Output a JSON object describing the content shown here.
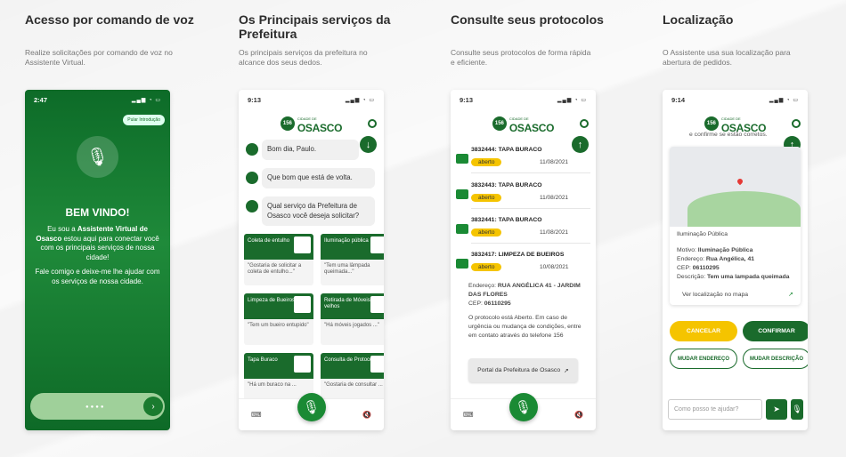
{
  "colors": {
    "green": "#1a6b2c",
    "accent_yellow": "#f5c400"
  },
  "columns": [
    {
      "title": "Acesso por comando de voz",
      "desc": "Realize solicitações por comando de voz no Assistente Virtual."
    },
    {
      "title": "Os Principais serviços da Prefeitura",
      "desc": "Os principais serviços da prefeitura no alcance dos seus dedos."
    },
    {
      "title": "Consulte seus protocolos",
      "desc": "Consulte seus protocolos de forma rápida e eficiente."
    },
    {
      "title": "Localização",
      "desc": "O Assistente usa sua localização para abertura de pedidos."
    }
  ],
  "logo": {
    "number": "156",
    "city_small": "CIDADE DE",
    "city": "OSASCO"
  },
  "phone1": {
    "time": "2:47",
    "skip": "Pular Introdução",
    "welcome": "BEM VINDO!",
    "intro_pre": "Eu sou a ",
    "intro_bold": "Assistente Virtual de Osasco",
    "intro_post": " estou aqui para conectar você com os principais serviços de nossa cidade!",
    "intro2": "Fale comigo e deixe-me lhe ajudar com os serviços de nossa cidade."
  },
  "phone2": {
    "time": "9:13",
    "msg1": "Bom dia, Paulo.",
    "msg2": "Que bom que está de volta.",
    "msg3": "Qual serviço da Prefeitura de Osasco você deseja solicitar?",
    "services": [
      {
        "title": "Coleta de entulho",
        "quote": "\"Gostaria de solicitar a coleta de entulho...\""
      },
      {
        "title": "Iluminação pública",
        "quote": "\"Tem uma lâmpada queimada...\""
      },
      {
        "title": "Limpeza de Bueiros",
        "quote": "\"Tem um bueiro entupido\""
      },
      {
        "title": "Retirada de Móveis velhos",
        "quote": "\"Há móveis jogados ...\""
      },
      {
        "title": "Tapa Buraco",
        "quote": "\"Há um buraco na ..."
      },
      {
        "title": "Consulta de Protocolo",
        "quote": "\"Gostaria de consultar ..."
      }
    ]
  },
  "phone3": {
    "time": "9:13",
    "protocols": [
      {
        "title": "3832444: TAPA BURACO",
        "status": "aberto",
        "date": "11/08/2021"
      },
      {
        "title": "3832443: TAPA BURACO",
        "status": "aberto",
        "date": "11/08/2021"
      },
      {
        "title": "3832441: TAPA BURACO",
        "status": "aberto",
        "date": "11/08/2021"
      },
      {
        "title": "3832417: LIMPEZA DE BUEIROS",
        "status": "aberto",
        "date": "10/08/2021"
      }
    ],
    "address_label": "Endereço: ",
    "address": "RUA ANGÉLICA 41 - JARDIM DAS FLORES",
    "cep_label": "CEP: ",
    "cep": "06110295",
    "info": "O protocolo está Aberto. Em caso de urgência ou mudança de condições, entre em contato através do telefone 156",
    "portal": "Portal da Prefeitura de Osasco"
  },
  "phone4": {
    "time": "9:14",
    "confirm_msg": "e confirme se estão corretos.",
    "category": "Iluminação Pública",
    "motivo_label": "Motivo: ",
    "motivo": "Iluminação Pública",
    "endereco_label": "Endereço: ",
    "endereco": "Rua Angélica, 41",
    "cep_label": "CEP: ",
    "cep": "06110295",
    "descricao_label": "Descrição: ",
    "descricao": "Tem uma lampada queimada",
    "map_link": "Ver localização no mapa",
    "cancel": "CANCELAR",
    "confirm": "CONFIRMAR",
    "change_address": "MUDAR ENDEREÇO",
    "change_desc": "MUDAR DESCRIÇÃO",
    "input_placeholder": "Como posso te ajudar?"
  }
}
